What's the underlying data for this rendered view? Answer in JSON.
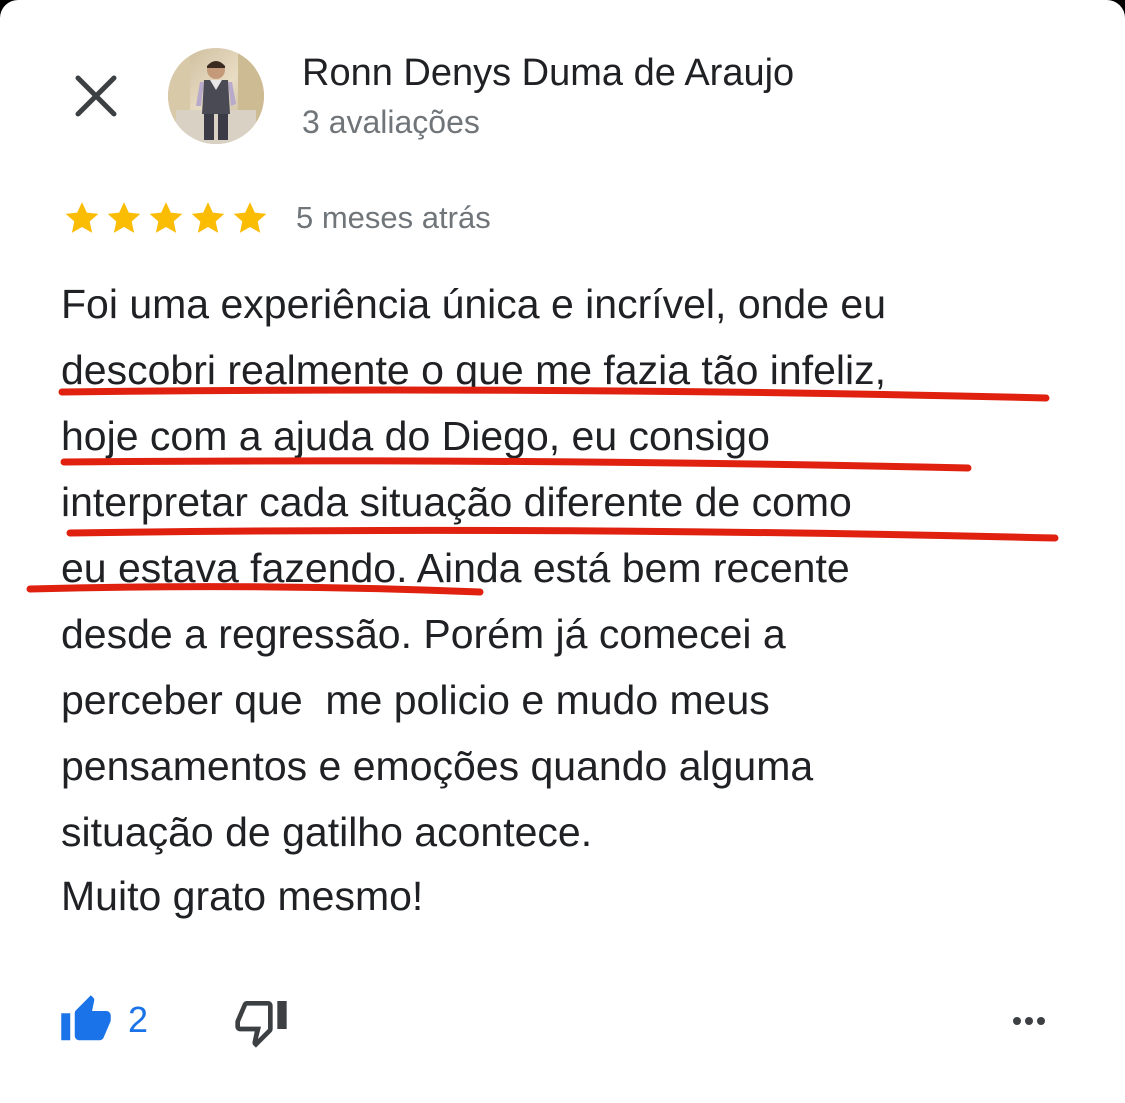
{
  "review": {
    "author_name": "Ronn Denys Duma de Araujo",
    "review_count": "3 avaliações",
    "rating": 5,
    "rating_max": 5,
    "time": "5 meses atrás",
    "lines": [
      "Foi uma experiência única e incrível, onde eu",
      "descobri realmente o que me fazia tão infeliz,",
      "hoje com a ajuda do Diego, eu consigo",
      "interpretar cada situação diferente de como",
      "eu estava fazendo. Ainda está bem recente",
      "desde a regressão. Porém já comecei a",
      "perceber que  me policio e mudo meus",
      "pensamentos e emoções quando alguma",
      "situação de gatilho acontece.",
      "Muito grato mesmo!"
    ]
  },
  "actions": {
    "like_count": "2",
    "like_icon": "thumbs-up-icon",
    "dislike_icon": "thumbs-down-icon",
    "more_icon": "more-horizontal-icon",
    "close_icon": "close-icon"
  },
  "colors": {
    "star": "#fbbc04",
    "accent_blue": "#1a73e8",
    "underline_red": "#e0210f",
    "text_primary": "#202124",
    "text_secondary": "#70757a"
  }
}
